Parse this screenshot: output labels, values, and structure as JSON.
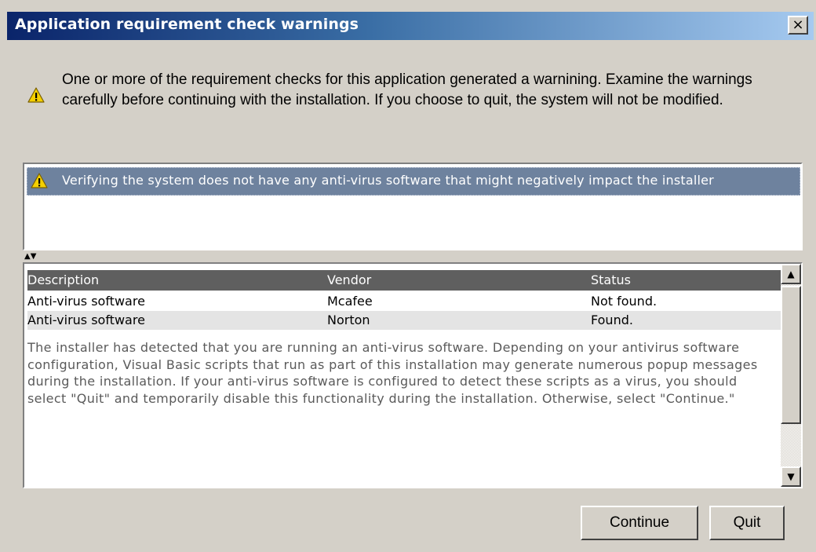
{
  "window": {
    "title": "Application requirement check warnings",
    "close_label": "×"
  },
  "intro": {
    "icon": "warning-icon",
    "text": "One or more of the requirement checks for this application generated a warnining. Examine the warnings carefully before continuing with the installation. If you choose to quit, the system will not be modified."
  },
  "warnings": {
    "items": [
      {
        "icon": "warning-icon",
        "label": "Verifying the system does not have any anti-virus software that might negatively impact the installer"
      }
    ]
  },
  "splitter": {
    "glyphs": "▲▼"
  },
  "details": {
    "columns": [
      "Description",
      "Vendor",
      "Status"
    ],
    "rows": [
      [
        "Anti-virus software",
        "Mcafee",
        "Not found."
      ],
      [
        "Anti-virus software",
        "Norton",
        "Found."
      ]
    ],
    "description": "The installer has detected that you are running an anti-virus software. Depending on your antivirus software configuration, Visual Basic scripts that run as part of this installation may generate numerous popup messages during the installation. If your anti-virus software is configured to detect these scripts as a virus, you should select \"Quit\" and temporarily disable this functionality during the installation. Otherwise, select \"Continue.\""
  },
  "scrollbar": {
    "up_glyph": "▲",
    "down_glyph": "▼"
  },
  "buttons": {
    "continue_label": "Continue",
    "quit_label": "Quit"
  },
  "colors": {
    "titlebar_start": "#0a246a",
    "titlebar_end": "#a6caf0",
    "selected_row": "#6e829e",
    "table_header": "#5f5f5f",
    "row_alt": "#e4e4e4"
  }
}
